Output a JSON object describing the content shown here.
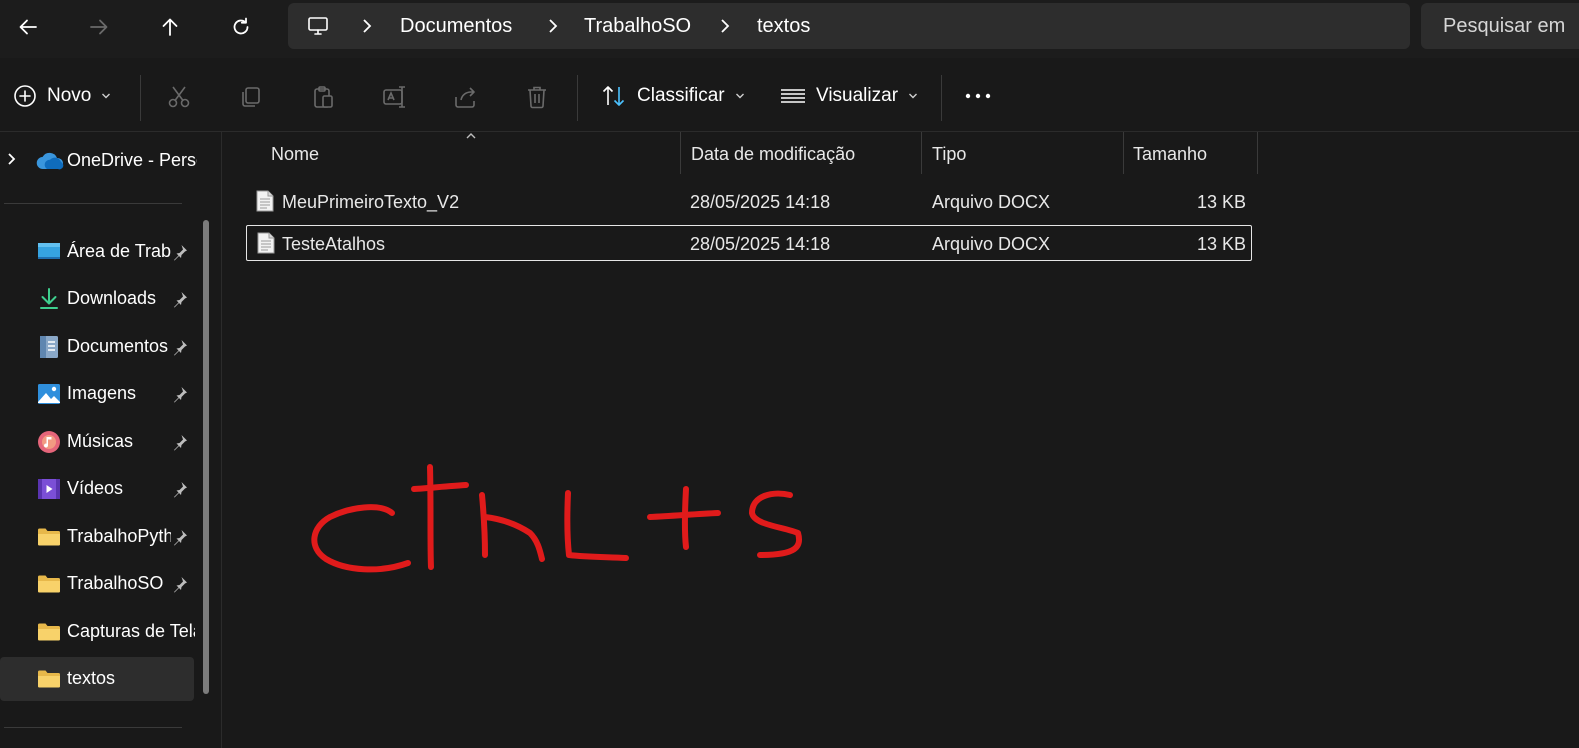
{
  "address_bar": {
    "breadcrumbs": [
      "Documentos",
      "TrabalhoSO",
      "textos"
    ],
    "search_placeholder": "Pesquisar em"
  },
  "toolbar": {
    "new_label": "Novo",
    "sort_label": "Classificar",
    "view_label": "Visualizar"
  },
  "sidebar": {
    "onedrive_label": "OneDrive - Perso",
    "items": [
      {
        "label": "Área de Trabalho",
        "icon": "desktop-icon",
        "pinned": true
      },
      {
        "label": "Downloads",
        "icon": "download-icon",
        "pinned": true
      },
      {
        "label": "Documentos",
        "icon": "documents-icon",
        "pinned": true
      },
      {
        "label": "Imagens",
        "icon": "pictures-icon",
        "pinned": true
      },
      {
        "label": "Músicas",
        "icon": "music-icon",
        "pinned": true
      },
      {
        "label": "Vídeos",
        "icon": "videos-icon",
        "pinned": true
      },
      {
        "label": "TrabalhoPython",
        "icon": "folder-icon",
        "pinned": true
      },
      {
        "label": "TrabalhoSO",
        "icon": "folder-icon",
        "pinned": true
      },
      {
        "label": "Capturas de Tela",
        "icon": "folder-icon",
        "pinned": false
      },
      {
        "label": "textos",
        "icon": "folder-icon",
        "pinned": false,
        "active": true
      }
    ]
  },
  "file_list": {
    "columns": [
      "Nome",
      "Data de modificação",
      "Tipo",
      "Tamanho"
    ],
    "rows": [
      {
        "name": "MeuPrimeiroTexto_V2",
        "modified": "28/05/2025 14:18",
        "type": "Arquivo DOCX",
        "size": "13 KB"
      },
      {
        "name": "TesteAtalhos",
        "modified": "28/05/2025 14:18",
        "type": "Arquivo DOCX",
        "size": "13 KB",
        "selected": true
      }
    ]
  },
  "annotation_color": "#e01b1b",
  "accent_color": "#4cc2ff"
}
